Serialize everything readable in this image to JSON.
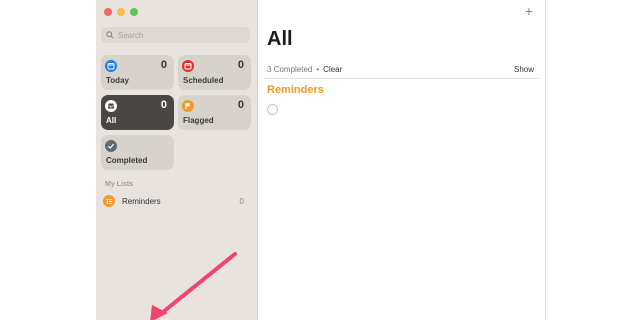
{
  "colors": {
    "close": "#ec6a5e",
    "minimize": "#f4bf4f",
    "zoom": "#61c554",
    "today": "#1a7fe9",
    "scheduled": "#e5302c",
    "all": "#4a4643",
    "flagged": "#f09a28",
    "completed": "#5f6a73",
    "reminders": "#ef9a2d",
    "annotation_arrow": "#f0446e"
  },
  "sidebar": {
    "search_placeholder": "Search",
    "tiles": [
      {
        "label": "Today",
        "count": "0",
        "icon": "calendar-icon"
      },
      {
        "label": "Scheduled",
        "count": "0",
        "icon": "calendar-icon"
      },
      {
        "label": "All",
        "count": "0",
        "icon": "tray-icon"
      },
      {
        "label": "Flagged",
        "count": "0",
        "icon": "flag-icon"
      },
      {
        "label": "Completed",
        "count": "",
        "icon": "checkmark-icon"
      }
    ],
    "my_lists_heading": "My Lists",
    "lists": [
      {
        "name": "Reminders",
        "count": "0",
        "icon": "list-bullet-icon"
      }
    ]
  },
  "main": {
    "add_symbol": "+",
    "title": "All",
    "completed_text": "3 Completed",
    "separator": "•",
    "clear_label": "Clear",
    "show_label": "Show",
    "section_title": "Reminders"
  }
}
